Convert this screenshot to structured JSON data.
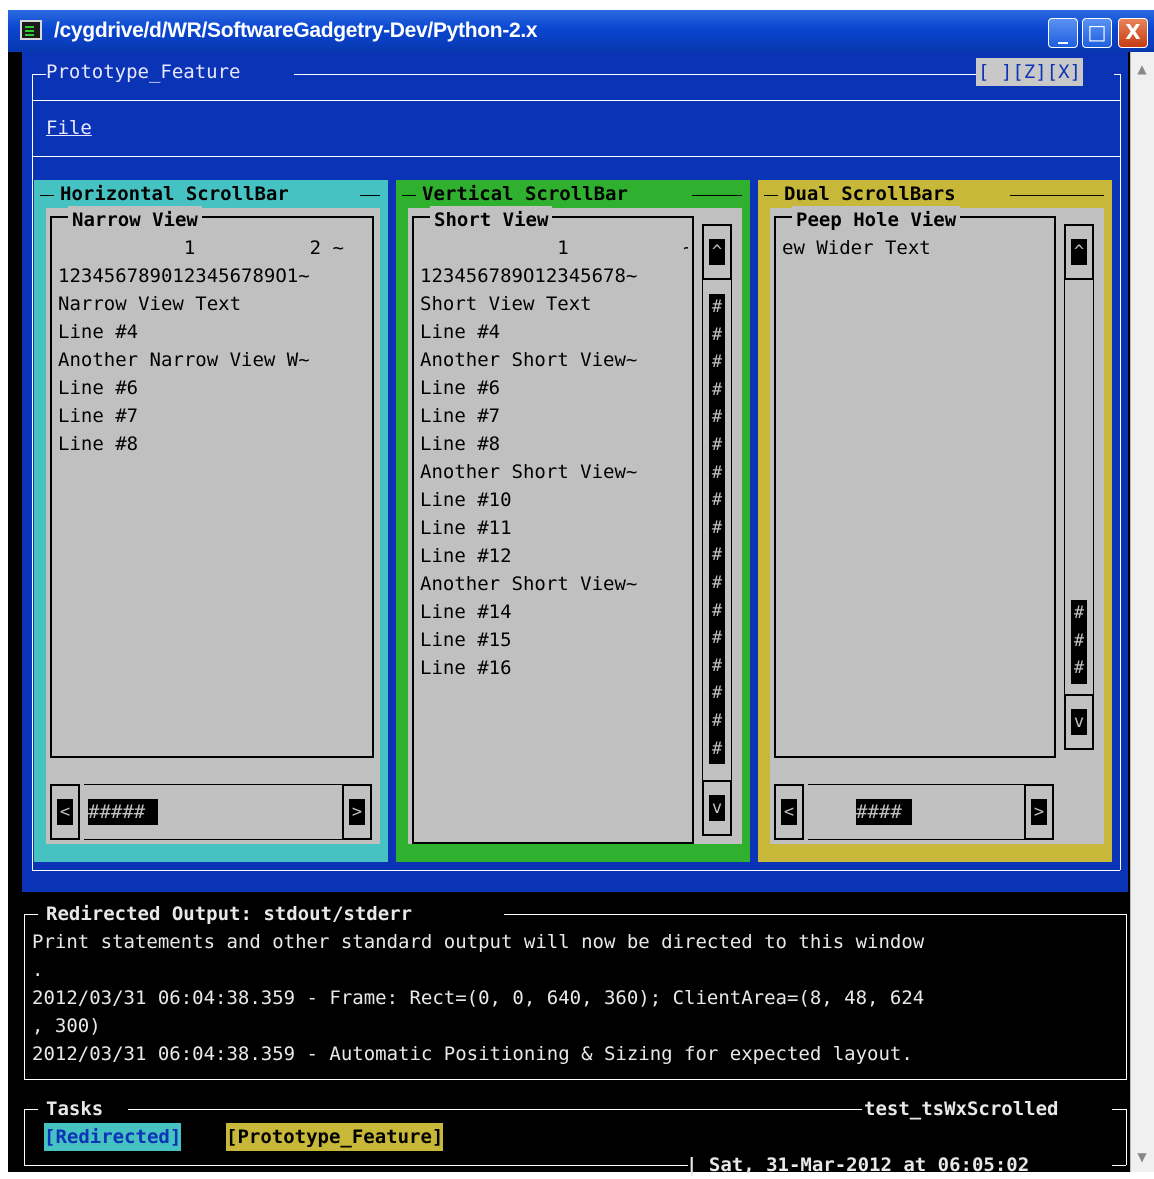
{
  "window": {
    "title": "/cygdrive/d/WR/SoftwareGadgetry-Dev/Python-2.x",
    "minimize_label": "_",
    "maximize_label": "□",
    "close_label": "X"
  },
  "frame": {
    "title": "Prototype_Feature",
    "buttons": "[ ][Z][X]",
    "menu": {
      "file_label": "File"
    }
  },
  "panels": {
    "horizontal": {
      "title": "Horizontal ScrollBar",
      "view_title": "Narrow View",
      "lines": [
        "           1          2 ~",
        "1234567890123456789O1~",
        "Narrow View Text",
        "Line #4",
        "Another Narrow View W~",
        "Line #6",
        "Line #7",
        "Line #8"
      ],
      "left_arrow": "<",
      "right_arrow": ">",
      "thumb": "#####"
    },
    "vertical": {
      "title": "Vertical ScrollBar",
      "view_title": "Short View",
      "lines": [
        "            1          ~",
        "123456789O12345678~",
        "Short View Text",
        "Line #4",
        "Another Short View~",
        "Line #6",
        "Line #7",
        "Line #8",
        "Another Short View~",
        "Line #10",
        "Line #11",
        "Line #12",
        "Another Short View~",
        "Line #14",
        "Line #15",
        "Line #16"
      ],
      "up_arrow": "^",
      "down_arrow": "v",
      "thumb": "#\n#\n#\n#\n#\n#\n#\n#\n#\n#\n#\n#\n#\n#\n#\n#\n#"
    },
    "dual": {
      "title": "Dual ScrollBars",
      "view_title": "Peep Hole View",
      "lines": [
        "",
        "ew Wider Text"
      ],
      "up_arrow": "^",
      "down_arrow": "v",
      "left_arrow": "<",
      "right_arrow": ">",
      "vthumb": "#\n#\n#",
      "hthumb": "####"
    }
  },
  "output": {
    "title": "Redirected Output: stdout/stderr",
    "lines": [
      "Print statements and other standard output will now be directed to this window",
      ".",
      "2012/03/31 06:04:38.359 - Frame: Rect=(0, 0, 640, 360); ClientArea=(8, 48, 624",
      ", 300)",
      "2012/03/31 06:04:38.359 - Automatic Positioning & Sizing for expected layout."
    ]
  },
  "tasks": {
    "title": "Tasks",
    "app_name": "test_tsWxScrolled",
    "items": [
      "[Redirected]",
      "[Prototype_Feature]"
    ],
    "datetime": "| Sat, 31-Mar-2012 at 06:05:02"
  },
  "colors": {
    "title_bar": "#0a46d0",
    "frame_bg": "#0b33b6",
    "horizontal_panel": "#46c2c2",
    "vertical_panel": "#2fb12f",
    "dual_panel": "#c8b83a",
    "view_bg": "#c0c0c0",
    "terminal_bg": "#000000",
    "redirected_tag": "#46c2c2",
    "prototype_tag": "#c8b83a"
  }
}
